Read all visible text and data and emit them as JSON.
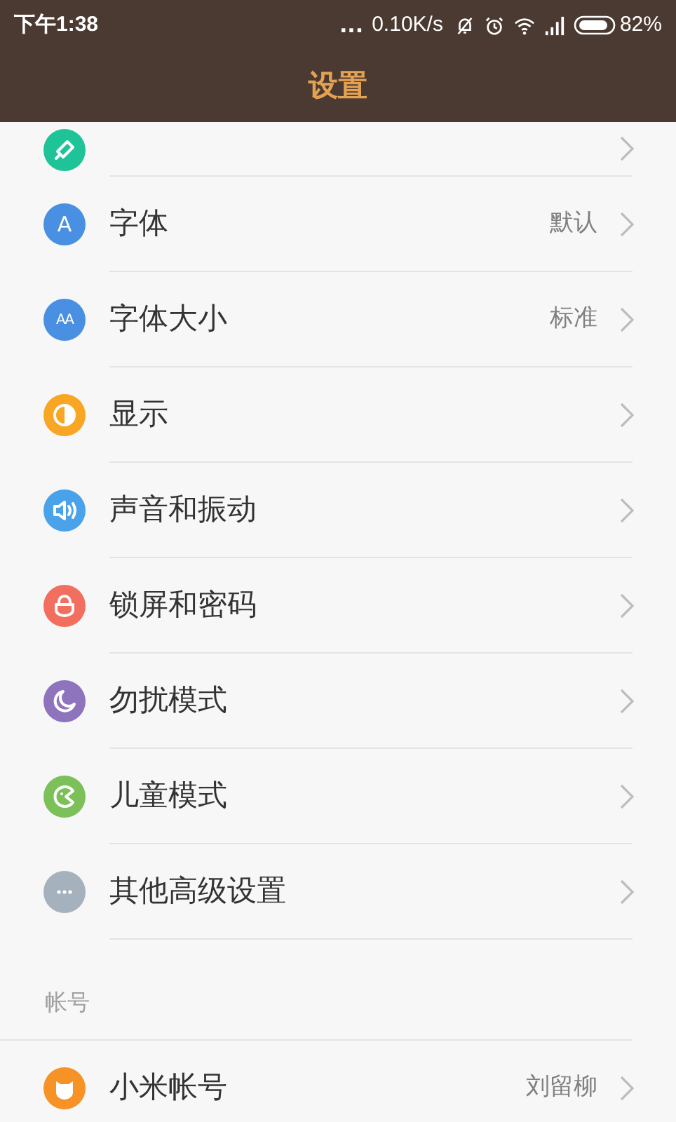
{
  "status_bar": {
    "time": "下午1:38",
    "more": "...",
    "speed": "0.10K/s",
    "battery": "82%"
  },
  "header": {
    "title": "设置"
  },
  "items": [
    {
      "color": "#1ec497"
    },
    {
      "label": "字体",
      "value": "默认",
      "color": "#4a90e2",
      "icon_text": "A"
    },
    {
      "label": "字体大小",
      "value": "标准",
      "color": "#4a90e2",
      "icon_text": "AA"
    },
    {
      "label": "显示",
      "color": "#f8a623"
    },
    {
      "label": "声音和振动",
      "color": "#4aa3ea"
    },
    {
      "label": "锁屏和密码",
      "color": "#f26e5e"
    },
    {
      "label": "勿扰模式",
      "color": "#8e74bd"
    },
    {
      "label": "儿童模式",
      "color": "#7cc05a"
    },
    {
      "label": "其他高级设置",
      "color": "#a6b1be"
    }
  ],
  "account_section": {
    "heading": "帐号",
    "items": [
      {
        "label": "小米帐号",
        "value": "刘留柳",
        "color": "#f79226"
      }
    ]
  }
}
